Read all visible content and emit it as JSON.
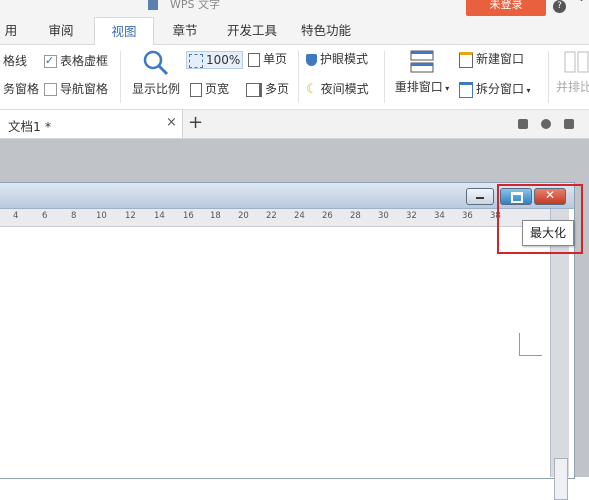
{
  "app": {
    "title": "WPS 文字",
    "login_label": "未登录"
  },
  "tabs": [
    "用",
    "审阅",
    "视图",
    "章节",
    "开发工具",
    "特色功能"
  ],
  "active_tab": "视图",
  "ribbon": {
    "gridlines_label": "格线",
    "table_gridlines_label": "表格虚框",
    "task_pane_label": "务窗格",
    "nav_pane_label": "导航窗格",
    "zoom_button_label": "显示比例",
    "zoom_value": "100%",
    "page_width_label": "页宽",
    "single_page_label": "单页",
    "multi_page_label": "多页",
    "eye_mode_label": "护眼模式",
    "night_mode_label": "夜间模式",
    "arrange_label": "重排窗口",
    "new_window_label": "新建窗口",
    "split_window_label": "拆分窗口",
    "side_by_side_label": "并排比"
  },
  "document_tab": {
    "label": "文档1 *",
    "close_symbol": "×",
    "new_tab_symbol": "+"
  },
  "ruler_ticks": [
    "4",
    "6",
    "8",
    "10",
    "12",
    "14",
    "16",
    "18",
    "20",
    "22",
    "24",
    "26",
    "28",
    "30",
    "32",
    "34",
    "36",
    "38"
  ],
  "tooltip": {
    "text": "最大化"
  },
  "colors": {
    "accent": "#3b6db3",
    "login_bg": "#e9603f",
    "highlight": "#d0262a",
    "close_btn": "#c23a22",
    "max_btn": "#2f80c0"
  },
  "icons": [
    "magnifier-icon",
    "zoom-100-icon",
    "page-width-icon",
    "single-page-icon",
    "multi-page-icon",
    "eye-shield-icon",
    "moon-icon",
    "arrange-windows-icon",
    "new-window-icon",
    "split-window-icon",
    "minimize-icon",
    "maximize-icon",
    "close-icon"
  ]
}
